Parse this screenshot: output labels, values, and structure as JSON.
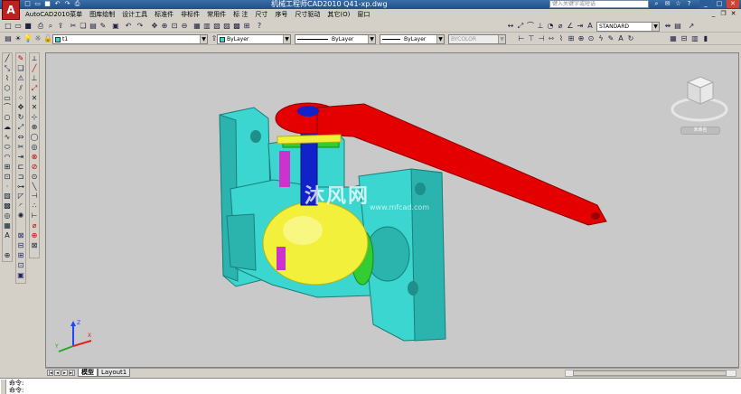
{
  "app": {
    "logo_letter": "A",
    "title": "机械工程师CAD2010   Q41-xp.dwg",
    "search_placeholder": "键入关键字或短语"
  },
  "menu": {
    "items": [
      "AutoCAD2010菜单",
      "图库绘制",
      "设计工具",
      "标准件",
      "非标件",
      "常用件",
      "标 注",
      "尺寸",
      "序号",
      "尺寸驱动",
      "其它(O)",
      "窗口"
    ]
  },
  "toolbar1": {
    "textstyle_value": "STANDARD"
  },
  "toolbar2": {
    "layer_value": "t1",
    "color_value": "ByLayer",
    "linetype_value": "ByLayer",
    "lineweight_value": "ByLayer",
    "plotstyle_value": "BYCOLOR"
  },
  "viewport": {
    "watermark_text": "沐风网",
    "watermark_url": "www.mfcad.com",
    "viewcube_label": "未命名",
    "ucs_x": "X",
    "ucs_y": "Y",
    "ucs_z": "Z"
  },
  "tabs": {
    "model": "模型",
    "layout1": "Layout1"
  },
  "command": {
    "line1": "命令:",
    "line2": "命令:"
  },
  "colors": {
    "valve_body": "#3ad6cf",
    "handle": "#e40000",
    "ball": "#f2f03a",
    "stem": "#1022c8",
    "seal": "#33cc33",
    "gasket": "#cc33cc",
    "viewport_bg": "#c9c9c9"
  },
  "icons": {
    "titlebar": [
      "new-icon",
      "open-icon",
      "save-icon",
      "undo-icon",
      "redo-icon",
      "print-icon"
    ],
    "left_toolbar_draw": [
      "line-icon",
      "construction-line-icon",
      "polyline-icon",
      "polygon-icon",
      "rectangle-icon",
      "arc-icon",
      "circle-icon",
      "revision-cloud-icon",
      "spline-icon",
      "ellipse-icon",
      "ellipse-arc-icon",
      "insert-block-icon",
      "make-block-icon",
      "point-icon",
      "hatch-icon",
      "gradient-icon",
      "region-icon",
      "table-icon",
      "multiline-text-icon"
    ],
    "left_toolbar_modify": [
      "erase-icon",
      "copy-icon",
      "mirror-icon",
      "offset-icon",
      "array-icon",
      "move-icon",
      "rotate-icon",
      "scale-icon",
      "stretch-icon",
      "trim-icon",
      "extend-icon",
      "break-point-icon",
      "break-icon",
      "join-icon",
      "chamfer-icon",
      "fillet-icon",
      "explode-icon"
    ]
  }
}
